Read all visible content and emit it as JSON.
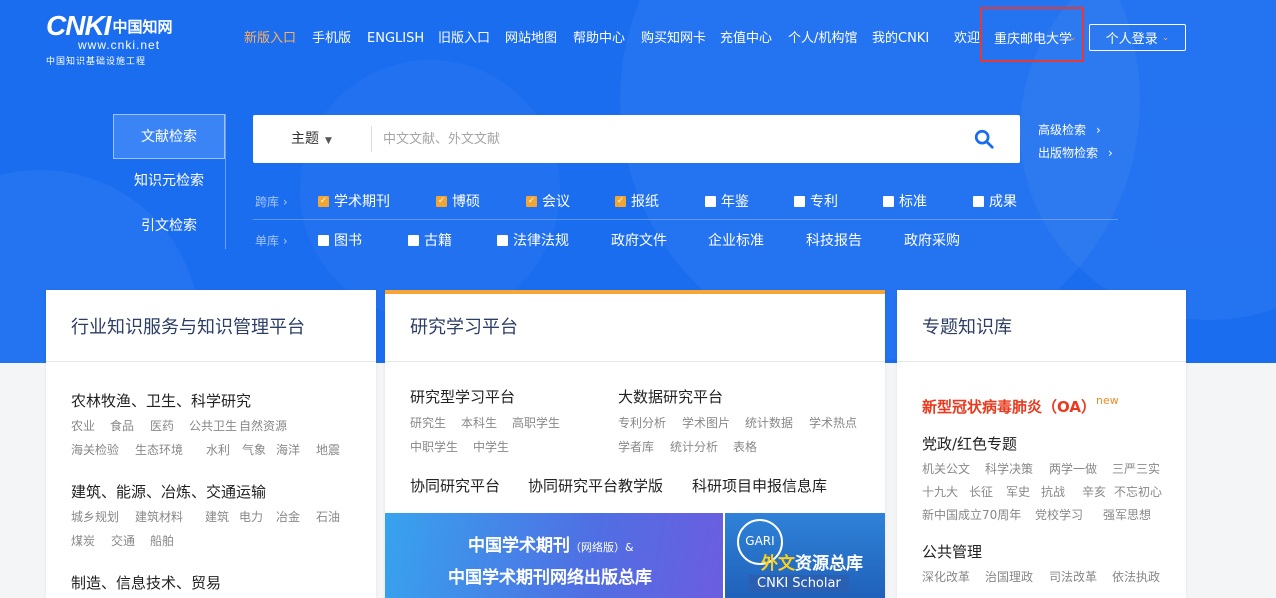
{
  "header": {
    "logo": {
      "brand": "CNKI",
      "brand_cn": "中国知网",
      "url": "www.cnki.net",
      "subtitle": "中国知识基础设施工程"
    },
    "nav": [
      "新版入口",
      "手机版",
      "ENGLISH",
      "旧版入口",
      "网站地图",
      "帮助中心",
      "购买知网卡",
      "充值中心",
      "个人/机构馆",
      "我的CNKI"
    ],
    "active_nav": "新版入口",
    "welcome": "欢迎",
    "institution": "重庆邮电大学",
    "login": "个人登录"
  },
  "search": {
    "tabs": [
      "文献检索",
      "知识元检索",
      "引文检索"
    ],
    "field": "主题",
    "placeholder": "中文文献、外文文献",
    "advanced": "高级检索",
    "publication": "出版物检索",
    "row1_label": "跨库",
    "row1": [
      {
        "label": "学术期刊",
        "checked": true
      },
      {
        "label": "博硕",
        "checked": true
      },
      {
        "label": "会议",
        "checked": true
      },
      {
        "label": "报纸",
        "checked": true
      },
      {
        "label": "年鉴",
        "checked": false
      },
      {
        "label": "专利",
        "checked": false
      },
      {
        "label": "标准",
        "checked": false
      },
      {
        "label": "成果",
        "checked": false
      }
    ],
    "row2_label": "单库",
    "row2_checks": [
      "图书",
      "古籍",
      "法律法规"
    ],
    "row2_links": [
      "政府文件",
      "企业标准",
      "科技报告",
      "政府采购"
    ]
  },
  "card1": {
    "title": "行业知识服务与知识管理平台",
    "groups": [
      {
        "title": "农林牧渔、卫生、科学研究",
        "rows": [
          [
            "农业",
            "食品",
            "医药",
            "公共卫生",
            "自然资源"
          ],
          [
            "海关检验",
            "生态环境",
            "水利",
            "气象",
            "海洋",
            "地震"
          ]
        ]
      },
      {
        "title": "建筑、能源、冶炼、交通运输",
        "rows": [
          [
            "城乡规划",
            "建筑材料",
            "建筑",
            "电力",
            "冶金",
            "石油"
          ],
          [
            "煤炭",
            "交通",
            "船舶"
          ]
        ]
      },
      {
        "title": "制造、信息技术、贸易",
        "rows": []
      }
    ]
  },
  "card2": {
    "title": "研究学习平台",
    "left": {
      "title": "研究型学习平台",
      "rows": [
        [
          "研究生",
          "本科生",
          "高职学生"
        ],
        [
          "中职学生",
          "中学生"
        ]
      ]
    },
    "right": {
      "title": "大数据研究平台",
      "rows": [
        [
          "专利分析",
          "学术图片",
          "统计数据",
          "学术热点"
        ],
        [
          "学者库",
          "统计分析",
          "表格"
        ]
      ]
    },
    "links": [
      "协同研究平台",
      "协同研究平台教学版",
      "科研项目申报信息库"
    ],
    "banner1": {
      "line1": "中国学术期刊",
      "line1_small": "（网络版）&",
      "line2": "中国学术期刊网络出版总库"
    },
    "banner2": {
      "badge": "GARI",
      "title_hl": "外文",
      "title": "资源总库",
      "sub": "CNKI Scholar"
    }
  },
  "card3": {
    "title": "专题知识库",
    "covid": "新型冠状病毒肺炎（OA）",
    "new_tag": "new",
    "group1": {
      "title": "党政/红色专题",
      "rows": [
        [
          "机关公文",
          "科学决策",
          "两学一做",
          "三严三实"
        ],
        [
          "十九大",
          "长征",
          "军史",
          "抗战",
          "辛亥",
          "不忘初心"
        ],
        [
          "新中国成立70周年",
          "党校学习",
          "强军思想"
        ]
      ]
    },
    "group2": {
      "title": "公共管理",
      "rows": [
        [
          "深化改革",
          "治国理政",
          "司法改革",
          "依法执政"
        ]
      ]
    }
  },
  "colors": {
    "hero": "#1b6df0",
    "accent": "#f7a537",
    "active_nav": "#ffb05a",
    "highlight_box": "#e53935"
  }
}
